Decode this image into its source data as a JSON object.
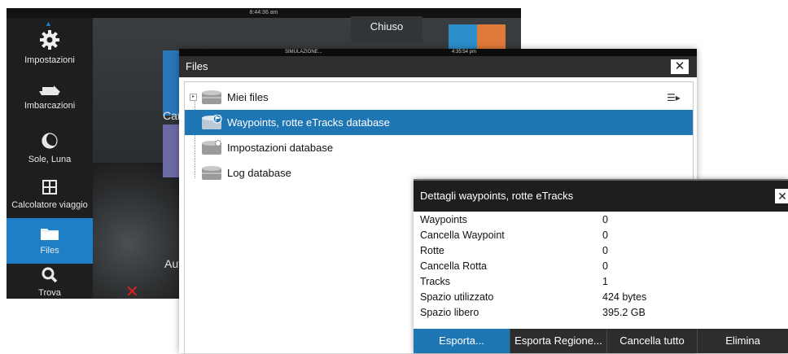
{
  "background": {
    "clock": "8:44:36 am",
    "sidebar": [
      {
        "label": "Impostazioni",
        "icon": "gear-icon"
      },
      {
        "label": "Imbarcazioni",
        "icon": "boats-icon"
      },
      {
        "label": "Sole, Luna",
        "icon": "sun-moon-icon"
      },
      {
        "label": "Calcolatore viaggio",
        "icon": "calculator-icon"
      },
      {
        "label": "Files",
        "icon": "folder-icon",
        "active": true
      },
      {
        "label": "Trova",
        "icon": "search-icon"
      }
    ],
    "chiuso_label": "Chiuso",
    "tile_car_label": "Car",
    "tile_aut_label": "Aut",
    "accent_color": "#1f7fc6"
  },
  "files_dialog": {
    "status_left": "SIMULAZIONE...",
    "status_time": "4:35:54 pm",
    "title": "Files",
    "close_label": "✕",
    "tree": [
      {
        "label": "Miei files",
        "icon": "database-icon",
        "selected": false
      },
      {
        "label": "Waypoints, rotte eTracks database",
        "icon": "database-flag-icon",
        "selected": true
      },
      {
        "label": "Impostazioni database",
        "icon": "database-gear-icon",
        "selected": false
      },
      {
        "label": "Log database",
        "icon": "database-icon",
        "selected": false
      }
    ],
    "selected_color": "#1f76b5"
  },
  "details_dialog": {
    "title": "Dettagli waypoints, rotte eTracks",
    "close_label": "✕",
    "rows": [
      {
        "key": "Waypoints",
        "value": "0"
      },
      {
        "key": "Cancella Waypoint",
        "value": "0"
      },
      {
        "key": "Rotte",
        "value": "0"
      },
      {
        "key": "Cancella Rotta",
        "value": "0"
      },
      {
        "key": "Tracks",
        "value": "1"
      },
      {
        "key": "Spazio utilizzato",
        "value": "424 bytes"
      },
      {
        "key": "Spazio libero",
        "value": "395.2 GB"
      }
    ],
    "buttons": [
      "Esporta...",
      "Esporta Regione...",
      "Cancella tutto",
      "Elimina"
    ]
  }
}
